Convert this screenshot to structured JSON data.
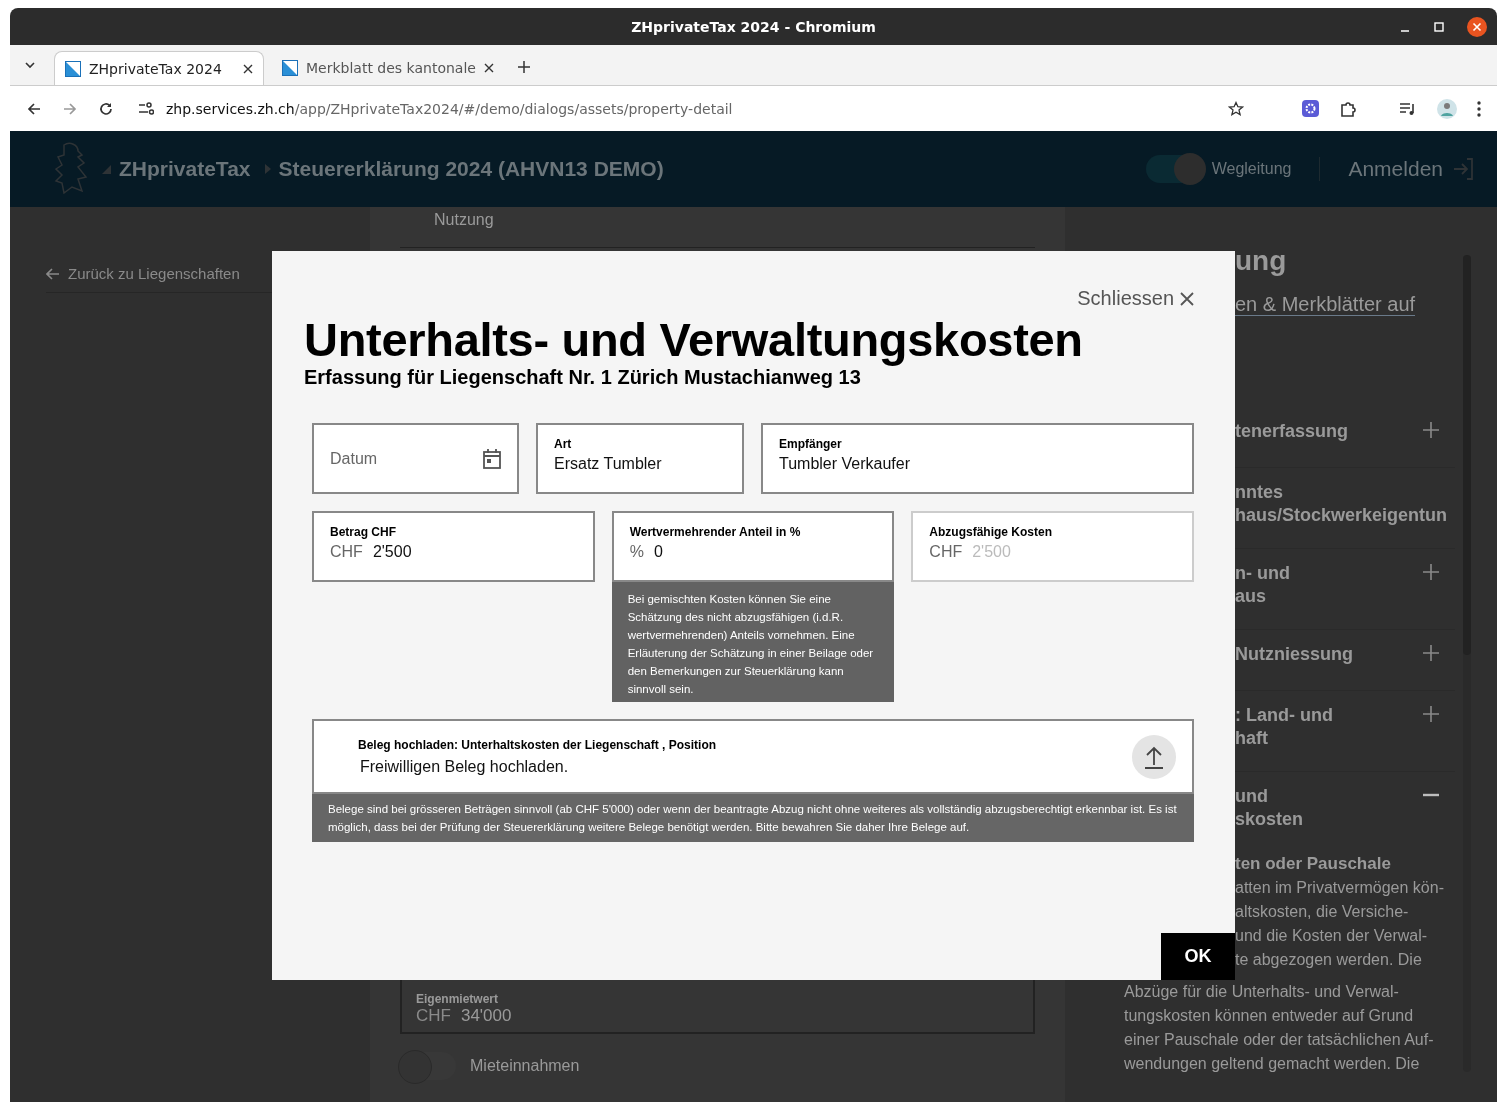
{
  "window": {
    "title": "ZHprivateTax 2024 - Chromium"
  },
  "tabs": [
    {
      "label": "ZHprivateTax 2024",
      "selected": true
    },
    {
      "label": "Merkblatt des kantonale",
      "selected": false
    }
  ],
  "address_bar": {
    "host": "zhp.services.zh.ch",
    "path": "/app/ZHprivateTax2024/#/demo/dialogs/assets/property-detail"
  },
  "app_header": {
    "brand": "ZHprivateTax",
    "breadcrumb": "Steuererklärung 2024 (AHVN13 DEMO)",
    "guide_toggle": {
      "label": "Wegleitung",
      "on": true
    },
    "login": "Anmelden"
  },
  "sidebar": {
    "back_link": "Zurück zu Liegenschaften"
  },
  "main": {
    "section_label": "Nutzung",
    "field": {
      "label": "Eigenmietwert",
      "prefix": "CHF",
      "value": "34'000"
    },
    "toggle": {
      "label": "Mieteinnahmen",
      "on": false
    }
  },
  "guide": {
    "title": "ung",
    "link": "en & Merkblätter auf",
    "items": [
      {
        "lines": [
          "tenerfassung"
        ],
        "expanded": false
      },
      {
        "lines": [
          "nntes",
          "haus/Stockwerkeigentun"
        ]
      },
      {
        "lines": [
          "n- und",
          "aus"
        ],
        "expanded": false
      },
      {
        "lines": [
          "Nutzniessung"
        ],
        "expanded": false
      },
      {
        "lines": [
          ": Land- und",
          "haft"
        ],
        "expanded": false
      },
      {
        "lines": [
          "und",
          "skosten"
        ],
        "expanded": true
      }
    ],
    "body_heading": "ten oder Pauschale",
    "covered_lines": [
      "atten im Privatvermögen kön-",
      "altskosten, die Versiche-",
      "und die Kosten der Verwal-",
      "te abgezogen werden. Die"
    ],
    "body_lines": [
      "Abzüge für die Unterhalts- und Verwal-",
      "tungskosten können entweder auf Grund",
      "einer Pauschale oder der tatsächlichen Auf-",
      "wendungen geltend gemacht werden. Die"
    ]
  },
  "dialog": {
    "close": "Schliessen",
    "title": "Unterhalts- und Verwaltungskosten",
    "subtitle": "Erfassung für Liegenschaft Nr. 1 Zürich Mustachianweg 13",
    "field_rows": [
      [
        {
          "kind": "date",
          "placeholder": "Datum"
        },
        {
          "kind": "text",
          "label": "Art",
          "value": "Ersatz Tumbler"
        },
        {
          "kind": "text",
          "label": "Empfänger",
          "value": "Tumbler Verkaufer"
        }
      ],
      [
        {
          "kind": "amount",
          "label": "Betrag CHF",
          "prefix": "CHF",
          "value": "2'500",
          "disabled": false
        },
        {
          "kind": "amount",
          "label": "Wertvermehrender Anteil in %",
          "prefix": "%",
          "value": "0",
          "disabled": false,
          "hint": "Bei gemischten Kosten können Sie eine Schätzung des nicht abzugsfähigen (i.d.R. wertvermehrenden) Anteils vornehmen. Eine Erläuterung der Schätzung in einer Beilage oder den Bemerkungen zur Steuerklärung kann sinnvoll sein."
        },
        {
          "kind": "amount",
          "label": "Abzugsfähige Kosten",
          "prefix": "CHF",
          "value": "2'500",
          "disabled": true
        }
      ]
    ],
    "upload": {
      "label": "Beleg hochladen: Unterhaltskosten der Liegenschaft , Position",
      "text": "Freiwilligen Beleg hochladen.",
      "hint": "Belege sind bei grösseren Beträgen sinnvoll (ab CHF 5'000) oder wenn der beantragte Abzug nicht ohne weiteres als vollständig abzugsberechtigt erkennbar ist. Es ist möglich, dass bei der Prüfung der Steuererklärung weitere Belege benötigt werden. Bitte bewahren Sie daher Ihre Belege auf."
    },
    "ok": "OK"
  }
}
